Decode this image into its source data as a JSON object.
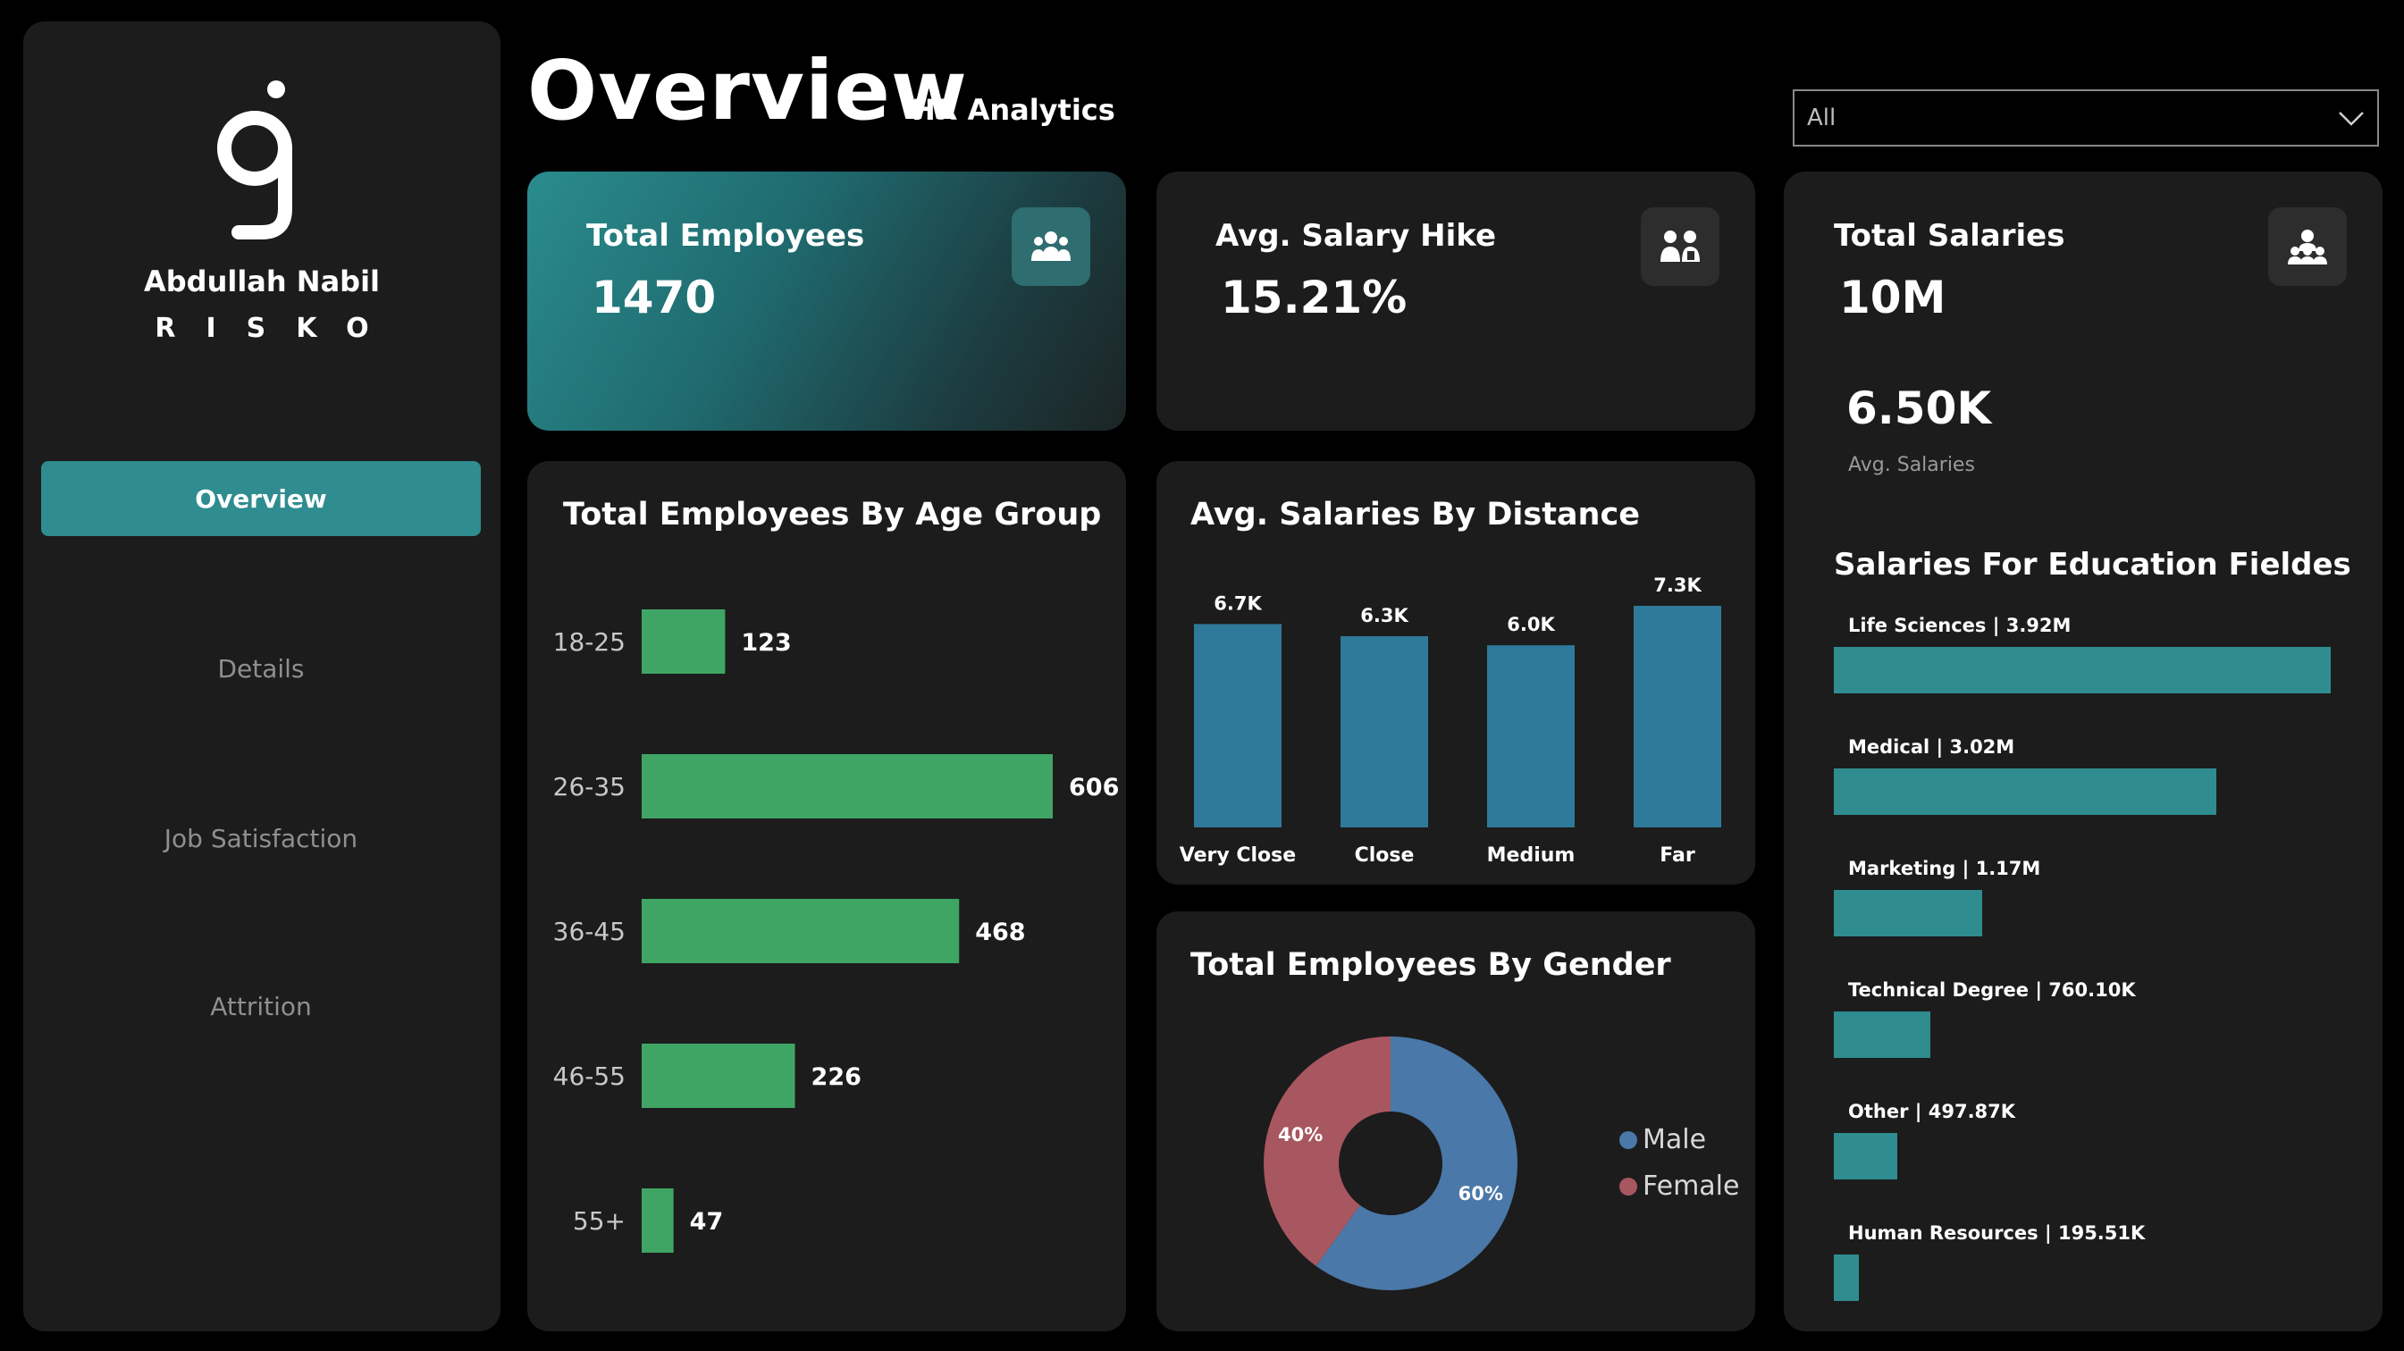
{
  "sidebar": {
    "brand_name": "Abdullah Nabil",
    "brand_sub": "RISKO",
    "nav": [
      {
        "label": "Overview",
        "active": true
      },
      {
        "label": "Details",
        "active": false
      },
      {
        "label": "Job Satisfaction",
        "active": false
      },
      {
        "label": "Attrition",
        "active": false
      }
    ]
  },
  "header": {
    "title": "Overview",
    "subtitle": "HR Analytics",
    "filter_value": "All"
  },
  "kpis": {
    "employees": {
      "title": "Total Employees",
      "value": "1470",
      "icon": "people-group-icon"
    },
    "hike": {
      "title": "Avg. Salary Hike",
      "value": "15.21%",
      "icon": "salary-hike-icon"
    },
    "salaries": {
      "title": "Total Salaries",
      "value": "10M",
      "icon": "team-icon"
    }
  },
  "avg_salaries": {
    "value": "6.50K",
    "label": "Avg. Salaries"
  },
  "education": {
    "title": "Salaries For Education Fieldes",
    "items": [
      {
        "label": "Life Sciences  |  3.92M",
        "value": 3.92
      },
      {
        "label": "Medical  |  3.02M",
        "value": 3.02
      },
      {
        "label": "Marketing  |  1.17M",
        "value": 1.17
      },
      {
        "label": "Technical Degree  |  760.10K",
        "value": 0.7601
      },
      {
        "label": "Other  |  497.87K",
        "value": 0.49787
      },
      {
        "label": "Human Resources  |  195.51K",
        "value": 0.19551
      }
    ]
  },
  "colors": {
    "teal": "#2f8c8f",
    "green": "#3fa564",
    "blue_bar": "#2f7a9a",
    "male": "#4a78a8",
    "female": "#a8565f"
  },
  "chart_data": [
    {
      "type": "bar",
      "title": "Total Employees By Age Group",
      "orientation": "horizontal",
      "categories": [
        "18-25",
        "26-35",
        "36-45",
        "46-55",
        "55+"
      ],
      "values": [
        123,
        606,
        468,
        226,
        47
      ],
      "labels": [
        "123",
        "606",
        "468",
        "226",
        "47"
      ]
    },
    {
      "type": "bar",
      "title": "Avg. Salaries By Distance",
      "categories": [
        "Very Close",
        "Close",
        "Medium",
        "Far"
      ],
      "values": [
        6.7,
        6.3,
        6.0,
        7.3
      ],
      "labels": [
        "6.7K",
        "6.3K",
        "6.0K",
        "7.3K"
      ]
    },
    {
      "type": "pie",
      "title": "Total Employees By Gender",
      "categories": [
        "Male",
        "Female"
      ],
      "values": [
        60,
        40
      ],
      "labels": [
        "60%",
        "40%"
      ]
    }
  ]
}
